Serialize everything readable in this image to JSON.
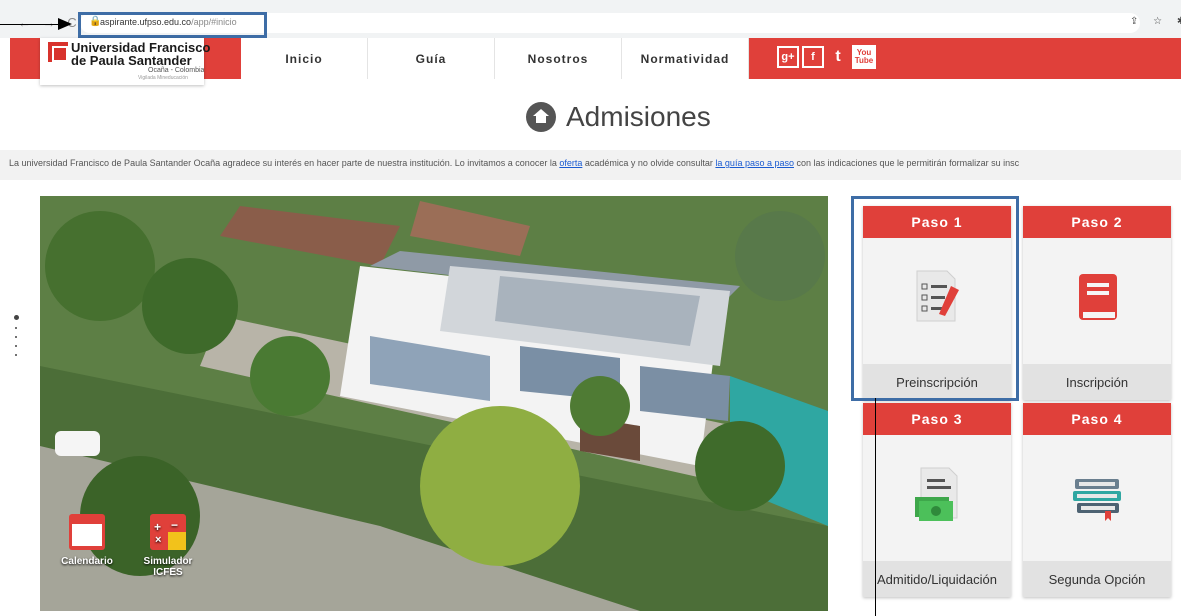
{
  "browser": {
    "url_host": "aspirante.ufpso.edu.co",
    "url_path": "/app/#inicio",
    "nav_icons": "← → C",
    "right_icons": "⇪ ☆ ✱ ▢"
  },
  "logo": {
    "line1": "Universidad Francisco",
    "line2": "de Paula Santander",
    "line3": "Ocaña - Colombia",
    "line4": "Vigilada Mineducación"
  },
  "nav": [
    "Inicio",
    "Guía",
    "Nosotros",
    "Normatividad"
  ],
  "social": {
    "googleplus": "g+",
    "facebook": "f",
    "twitter": "t",
    "youtube_top": "You",
    "youtube_bottom": "Tube"
  },
  "page": {
    "title": "Admisiones",
    "intro_before": "La universidad Francisco de Paula Santander Ocaña agradece su interés en hacer parte de nuestra institución. Lo invitamos a conocer la ",
    "intro_link1": "oferta",
    "intro_mid": " académica y no olvide consultar ",
    "intro_link2": "la guía paso a paso",
    "intro_after": " con las indicaciones que le permitirán formalizar su insc"
  },
  "quick_access": [
    {
      "label": "Calendario",
      "icon": "calendar-icon"
    },
    {
      "label": "Simulador ICFES",
      "icon": "calculator-icon"
    }
  ],
  "steps": [
    {
      "title": "Paso 1",
      "label": "Preinscripción",
      "icon": "checklist-icon"
    },
    {
      "title": "Paso 2",
      "label": "Inscripción",
      "icon": "book-icon"
    },
    {
      "title": "Paso 3",
      "label": "Admitido/Liquidación",
      "icon": "payment-document-icon"
    },
    {
      "title": "Paso 4",
      "label": "Segunda Opción",
      "icon": "books-stack-icon"
    }
  ],
  "colors": {
    "brand_red": "#e0403a",
    "highlight_blue": "#3e6da6",
    "link_blue": "#1a5bd1"
  }
}
